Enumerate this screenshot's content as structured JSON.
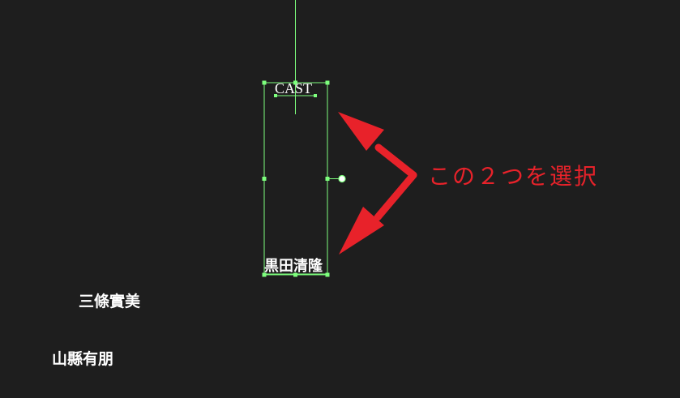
{
  "layers": {
    "cast": "CAST",
    "kuroda": "黒田清隆",
    "sanjo": "三條實美",
    "yamagata": "山縣有朋"
  },
  "annotation": {
    "text": "この２つを選択",
    "color": "#e8222a"
  },
  "colors": {
    "background": "#1e1e1e",
    "selection": "#7dff7d",
    "text": "#ffffff"
  }
}
